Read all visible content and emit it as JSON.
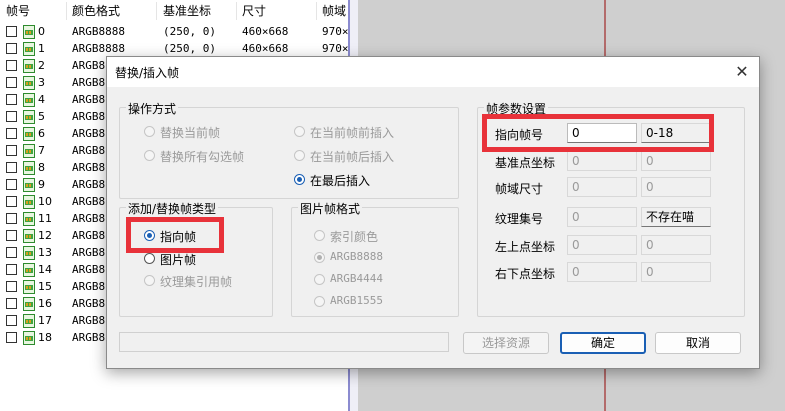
{
  "list": {
    "headers": [
      "帧号",
      "颜色格式",
      "基准坐标",
      "尺寸",
      "帧域"
    ],
    "rows": [
      {
        "num": "0",
        "fmt": "ARGB8888",
        "pos": "(250, 0)",
        "size": "460×668",
        "area": "970×"
      },
      {
        "num": "1",
        "fmt": "ARGB8888",
        "pos": "(250, 0)",
        "size": "460×668",
        "area": "970×"
      },
      {
        "num": "2",
        "fmt": "ARGB8"
      },
      {
        "num": "3",
        "fmt": "ARGB8"
      },
      {
        "num": "4",
        "fmt": "ARGB8"
      },
      {
        "num": "5",
        "fmt": "ARGB8"
      },
      {
        "num": "6",
        "fmt": "ARGB8"
      },
      {
        "num": "7",
        "fmt": "ARGB8"
      },
      {
        "num": "8",
        "fmt": "ARGB8"
      },
      {
        "num": "9",
        "fmt": "ARGB8"
      },
      {
        "num": "10",
        "fmt": "ARGB8"
      },
      {
        "num": "11",
        "fmt": "ARGB8"
      },
      {
        "num": "12",
        "fmt": "ARGB8"
      },
      {
        "num": "13",
        "fmt": "ARGB8"
      },
      {
        "num": "14",
        "fmt": "ARGB8"
      },
      {
        "num": "15",
        "fmt": "ARGB8"
      },
      {
        "num": "16",
        "fmt": "ARGB8"
      },
      {
        "num": "17",
        "fmt": "ARGB8"
      },
      {
        "num": "18",
        "fmt": "ARGB8"
      }
    ]
  },
  "dialog": {
    "title": "替换/插入帧",
    "close_glyph": "✕",
    "operation": {
      "label": "操作方式",
      "replace_current": "替换当前帧",
      "replace_checked": "替换所有勾选帧",
      "insert_before": "在当前帧前插入",
      "insert_after": "在当前帧后插入",
      "insert_last": "在最后插入"
    },
    "add_type": {
      "label": "添加/替换帧类型",
      "pointer_frame": "指向帧",
      "image_frame": "图片帧",
      "texture_ref_frame": "纹理集引用帧"
    },
    "image_format": {
      "label": "图片帧格式",
      "indexed": "索引颜色",
      "argb8888": "ARGB8888",
      "argb4444": "ARGB4444",
      "argb1555": "ARGB1555"
    },
    "params": {
      "label": "帧参数设置",
      "target_frame_label": "指向帧号",
      "target_frame_value": "0",
      "target_frame_range": "0-18",
      "base_point_label": "基准点坐标",
      "base_x": "0",
      "base_y": "0",
      "frame_area_label": "帧域尺寸",
      "area_w": "0",
      "area_h": "0",
      "texture_set_label": "纹理集号",
      "texture_set_value": "0",
      "texture_set_status": "不存在喵",
      "top_left_label": "左上点坐标",
      "tl_x": "0",
      "tl_y": "0",
      "bottom_right_label": "右下点坐标",
      "br_x": "0",
      "br_y": "0"
    },
    "buttons": {
      "select_resource": "选择资源",
      "ok": "确定",
      "cancel": "取消"
    }
  }
}
